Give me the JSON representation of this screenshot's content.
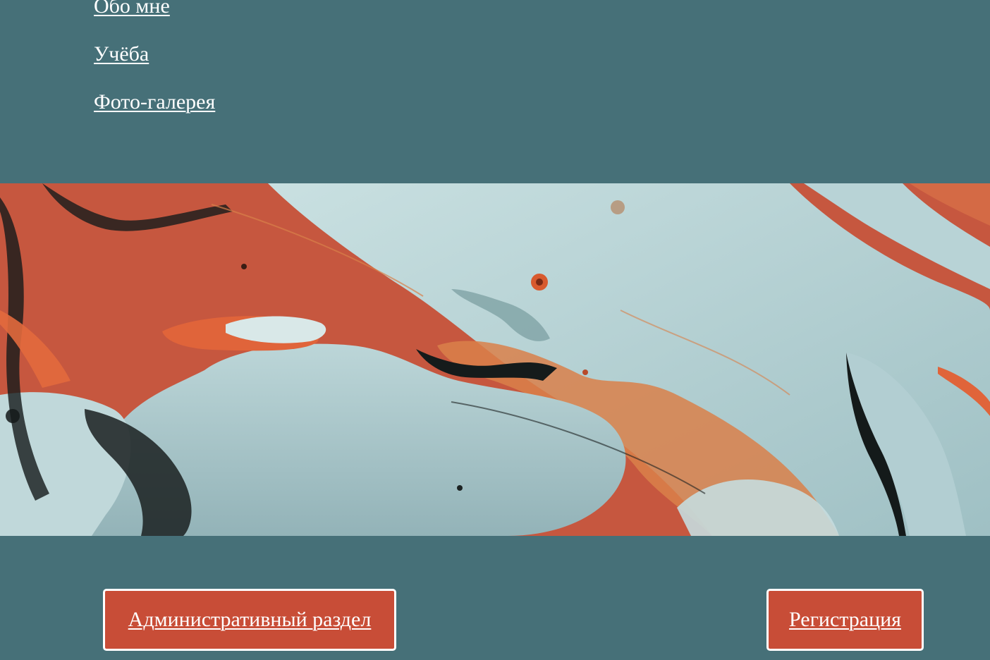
{
  "nav": {
    "items": [
      {
        "label": "Обо мне"
      },
      {
        "label": "Учёба"
      },
      {
        "label": "Фото-галерея"
      }
    ]
  },
  "banner": {
    "image": "abstract-fluid-paint-art",
    "colors": {
      "teal_background": "#467078",
      "rust": "#c6573f",
      "orange": "#e0643a",
      "pale_blue": "#b9d4d6",
      "ink": "#141a1a"
    }
  },
  "buttons": {
    "admin_label": "Административный раздел",
    "register_label": "Регистрация"
  }
}
